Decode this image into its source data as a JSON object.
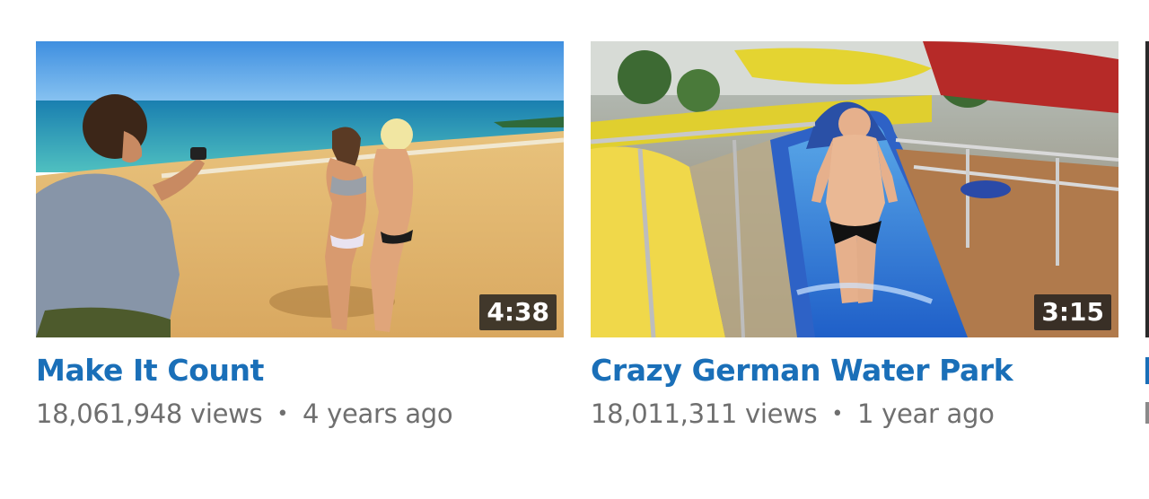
{
  "videos": [
    {
      "title": "Make It Count",
      "views": "18,061,948 views",
      "separator": "•",
      "age": "4 years ago",
      "duration": "4:38"
    },
    {
      "title": "Crazy German Water Park",
      "views": "18,011,311 views",
      "separator": "•",
      "age": "1 year ago",
      "duration": "3:15"
    }
  ],
  "colors": {
    "title": "#1a6fb8",
    "meta": "#6f6f6f",
    "duration_bg": "#1e1e1e",
    "duration_text": "#ffffff"
  }
}
